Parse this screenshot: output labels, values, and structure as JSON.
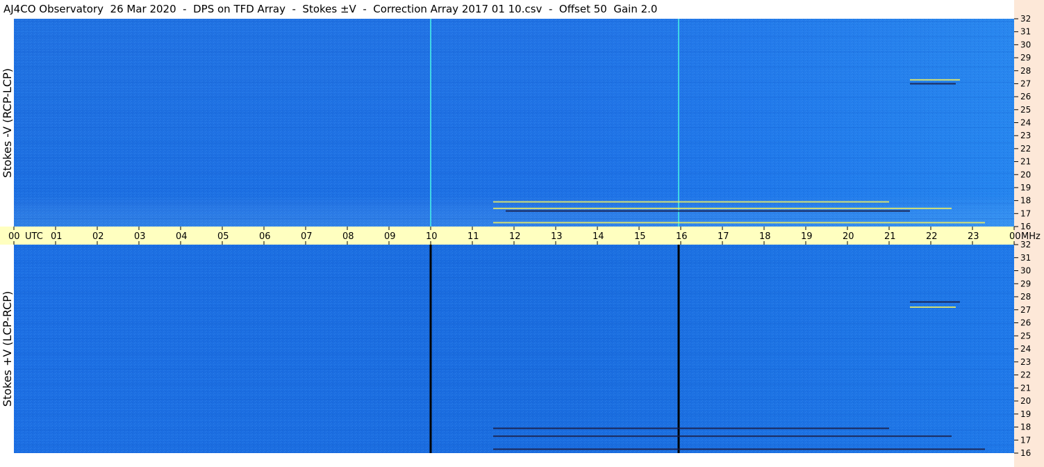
{
  "header": {
    "title": "AJ4CO Observatory  26 Mar 2020  -  DPS on TFD Array  -  Stokes ±V  -  Correction Array 2017 01 10.csv  -  Offset 50  Gain 2.0"
  },
  "colors": {
    "background_blue": "#1d72e6",
    "band_background": "#ffffc0",
    "side_strip": "#fde8d8",
    "top_vertical_line": "#3fd6e6",
    "bottom_vertical_line": "#000000",
    "burst_yellow": "#f0f060",
    "burst_dark": "#1a1a40"
  },
  "chart_data": [
    {
      "type": "heatmap",
      "panel": "top",
      "ylabel": "Stokes -V (RCP-LCP)",
      "x_hours_ticks": [
        "00",
        "01",
        "02",
        "03",
        "04",
        "05",
        "06",
        "07",
        "08",
        "09",
        "10",
        "11",
        "12",
        "13",
        "14",
        "15",
        "16",
        "17",
        "18",
        "19",
        "20",
        "21",
        "22",
        "23",
        "00"
      ],
      "x_unit_label": "UTC",
      "y_unit_label": "MHz",
      "y_ticks": [
        "32",
        "31",
        "30",
        "29",
        "28",
        "27",
        "26",
        "25",
        "24",
        "23",
        "22",
        "21",
        "20",
        "19",
        "18",
        "17",
        "16"
      ],
      "xlim_hours": [
        0,
        24
      ],
      "ylim_mhz": [
        16,
        32
      ],
      "vertical_lines_hours": [
        10.0,
        15.95
      ],
      "vertical_line_color": "cyan",
      "bursts": [
        {
          "hours": [
            11.5,
            21.0
          ],
          "mhz": 17.9,
          "color": "yellow"
        },
        {
          "hours": [
            11.5,
            22.5
          ],
          "mhz": 17.4,
          "color": "yellow"
        },
        {
          "hours": [
            11.8,
            21.5
          ],
          "mhz": 17.2,
          "color": "dark"
        },
        {
          "hours": [
            11.5,
            23.3
          ],
          "mhz": 16.3,
          "color": "yellow"
        },
        {
          "hours": [
            21.5,
            22.7
          ],
          "mhz": 27.3,
          "color": "yellow"
        },
        {
          "hours": [
            21.5,
            22.6
          ],
          "mhz": 27.0,
          "color": "dark"
        }
      ]
    },
    {
      "type": "heatmap",
      "panel": "bottom",
      "ylabel": "Stokes +V (LCP-RCP)",
      "y_ticks": [
        "32",
        "31",
        "30",
        "29",
        "28",
        "27",
        "26",
        "25",
        "24",
        "23",
        "22",
        "21",
        "20",
        "19",
        "18",
        "17",
        "16"
      ],
      "xlim_hours": [
        0,
        24
      ],
      "ylim_mhz": [
        16,
        32
      ],
      "vertical_lines_hours": [
        10.0,
        15.95
      ],
      "vertical_line_color": "black",
      "bursts": [
        {
          "hours": [
            11.5,
            21.0
          ],
          "mhz": 17.9,
          "color": "dark"
        },
        {
          "hours": [
            11.5,
            22.5
          ],
          "mhz": 17.3,
          "color": "dark"
        },
        {
          "hours": [
            11.5,
            23.3
          ],
          "mhz": 16.3,
          "color": "dark"
        },
        {
          "hours": [
            21.5,
            22.7
          ],
          "mhz": 27.6,
          "color": "dark"
        },
        {
          "hours": [
            21.5,
            22.6
          ],
          "mhz": 27.2,
          "color": "yellow"
        }
      ]
    }
  ]
}
